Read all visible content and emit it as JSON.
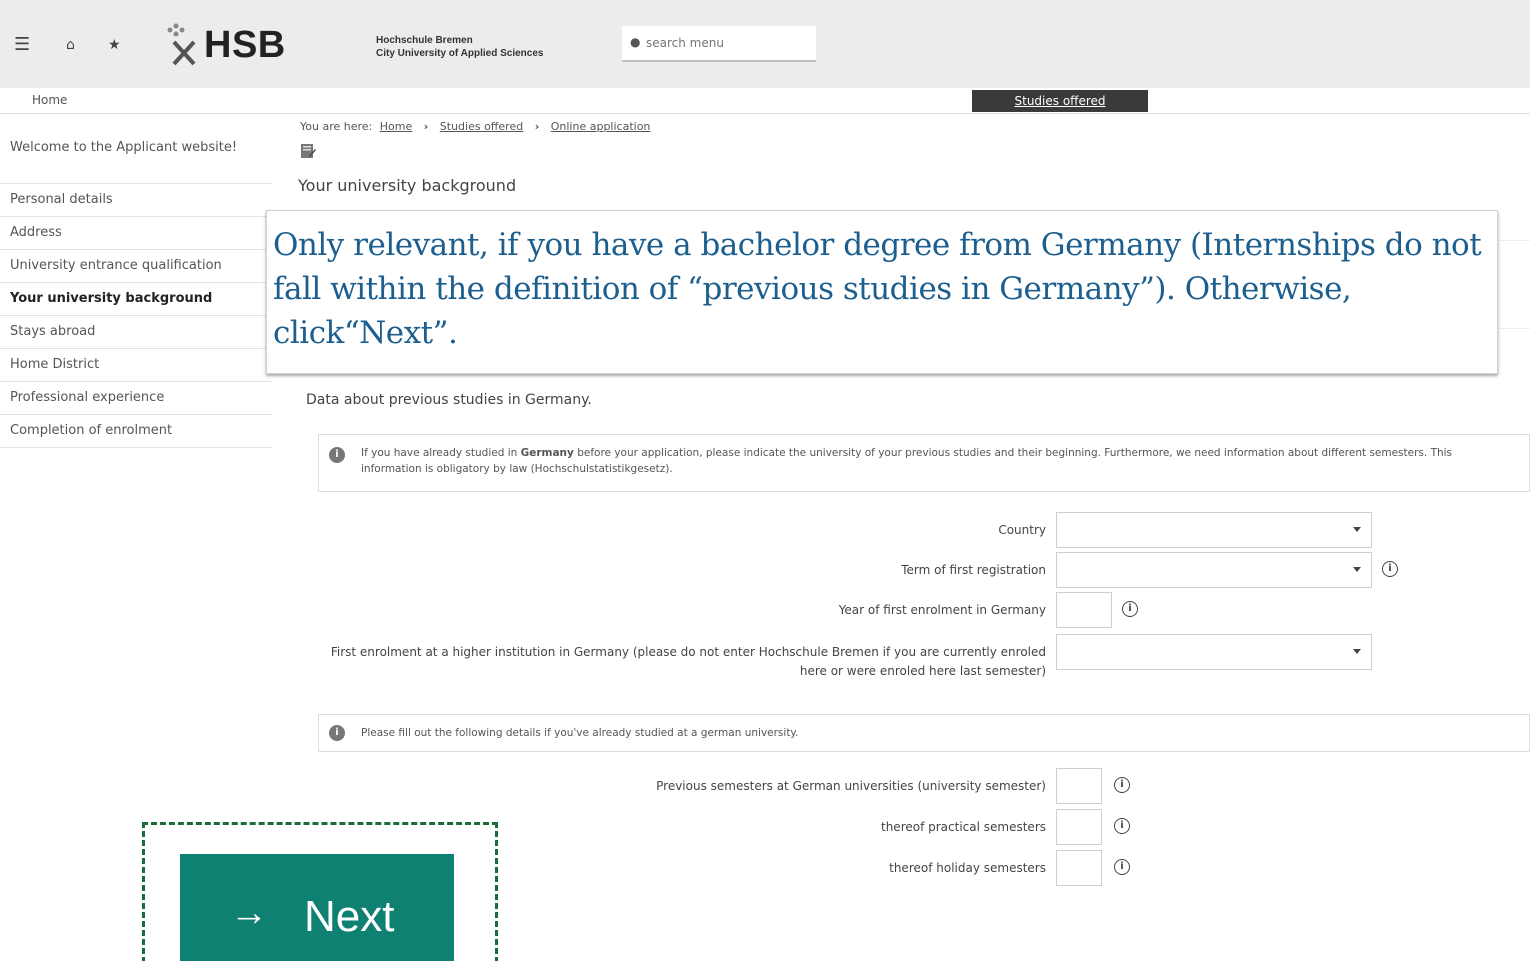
{
  "header": {
    "logo": "HSB",
    "university_line1": "Hochschule Bremen",
    "university_line2": "City University of Applied Sciences",
    "search_placeholder": "search menu"
  },
  "nav": {
    "home": "Home",
    "active_tab": "Studies offered"
  },
  "sidebar": {
    "items": [
      {
        "label": "Welcome to the Applicant website!"
      },
      {
        "label": "Personal details"
      },
      {
        "label": "Address"
      },
      {
        "label": "University entrance qualification"
      },
      {
        "label": "Your university background"
      },
      {
        "label": "Stays abroad"
      },
      {
        "label": "Home District"
      },
      {
        "label": "Professional experience"
      },
      {
        "label": "Completion of enrolment"
      }
    ]
  },
  "breadcrumb": {
    "prefix": "You are here:",
    "items": [
      "Home",
      "Studies offered",
      "Online application"
    ]
  },
  "page_title": "Your university background",
  "callout": "Only relevant, if you have a bachelor degree from Germany (Internships do not fall within the definition of “previous studies in Germany”). Otherwise, click“Next”.",
  "section_title": "Data about previous studies in Germany.",
  "info1": {
    "before_bold": "If you have already studied in ",
    "bold": "Germany",
    "after_bold": " before your application, please indicate the university of your previous studies and their beginning. Furthermore, we need information about different semesters. This information is obligatory by law (Hochschulstatistikgesetz)."
  },
  "form": {
    "country": "Country",
    "term": "Term of first registration",
    "year": "Year of first enrolment in Germany",
    "first_enrolment": "First enrolment at a higher institution in Germany (please do not enter Hochschule Bremen if you are currently enroled here or were enroled here last semester)"
  },
  "info2": "Please fill out the following details if you've already studied at a german university.",
  "semesters": {
    "previous": "Previous semesters at German universities (university semester)",
    "practical": "thereof practical semesters",
    "holiday": "thereof holiday semesters"
  },
  "next_button": "Next"
}
